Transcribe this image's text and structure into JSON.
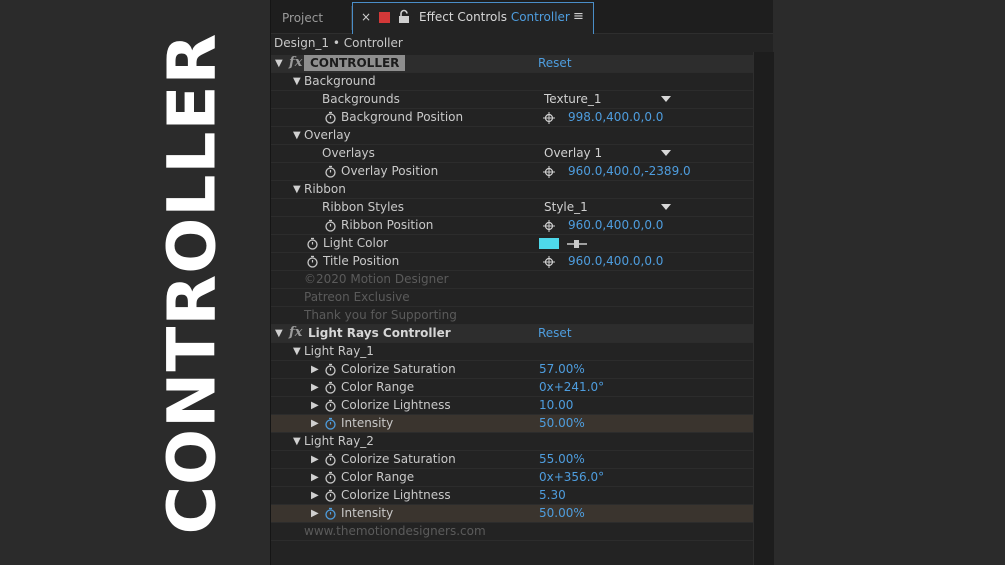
{
  "side_title": "CONTROLLER",
  "tabs": {
    "project": "Project",
    "effect_controls_prefix": "Effect Controls",
    "effect_controls_target": "Controller",
    "close": "×",
    "menu": "≡"
  },
  "breadcrumb": "Design_1 • Controller",
  "controller": {
    "name": "CONTROLLER",
    "reset": "Reset",
    "background_group": "Background",
    "backgrounds_label": "Backgrounds",
    "backgrounds_value": "Texture_1",
    "background_position_label": "Background Position",
    "background_position_value": "998.0,400.0,0.0",
    "overlay_group": "Overlay",
    "overlays_label": "Overlays",
    "overlays_value": "Overlay 1",
    "overlay_position_label": "Overlay Position",
    "overlay_position_value": "960.0,400.0,-2389.0",
    "ribbon_group": "Ribbon",
    "ribbon_styles_label": "Ribbon Styles",
    "ribbon_styles_value": "Style_1",
    "ribbon_position_label": "Ribbon Position",
    "ribbon_position_value": "960.0,400.0,0.0",
    "light_color_label": "Light Color",
    "light_color_value": "#4ed8ea",
    "title_position_label": "Title Position",
    "title_position_value": "960.0,400.0,0.0",
    "credit_1": "©2020 Motion Designer",
    "credit_2": "Patreon Exclusive",
    "credit_3": "Thank you for Supporting"
  },
  "light_rays": {
    "name": "Light Rays Controller",
    "reset": "Reset",
    "ray1_group": "Light Ray_1",
    "ray1_sat_label": "Colorize Saturation",
    "ray1_sat_value": "57.00%",
    "ray1_range_label": "Color Range",
    "ray1_range_value": "0x+241.0°",
    "ray1_light_label": "Colorize Lightness",
    "ray1_light_value": "10.00",
    "ray1_int_label": "Intensity",
    "ray1_int_value": "50.00%",
    "ray2_group": "Light Ray_2",
    "ray2_sat_label": "Colorize Saturation",
    "ray2_sat_value": "55.00%",
    "ray2_range_label": "Color Range",
    "ray2_range_value": "0x+356.0°",
    "ray2_light_label": "Colorize Lightness",
    "ray2_light_value": "5.30",
    "ray2_int_label": "Intensity",
    "ray2_int_value": "50.00%",
    "website": "www.themotiondesigners.com"
  },
  "colors": {
    "accent_blue": "#4e9dde",
    "tab_border": "#4a8ec8",
    "stopwatch_active": "#4e9dde",
    "lock_red": "#d33838"
  }
}
